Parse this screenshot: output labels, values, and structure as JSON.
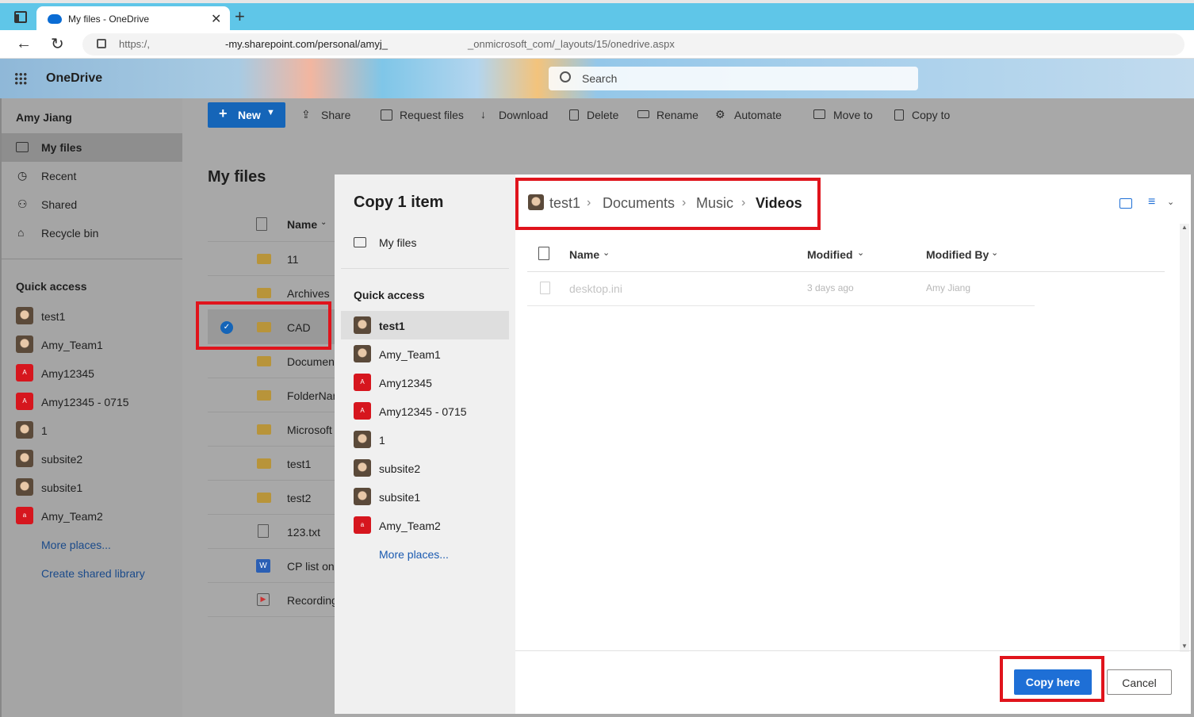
{
  "browser": {
    "tab_title": "My files - OneDrive",
    "tab_close": "✕",
    "new_tab": "+",
    "url_prefix": "https:/,",
    "url_middle": "-my.sharepoint.com/personal/amyj_",
    "url_suffix": "_onmicrosoft_com/_layouts/15/onedrive.aspx"
  },
  "header": {
    "app_name": "OneDrive",
    "search_placeholder": "Search"
  },
  "sidebar": {
    "user": "Amy Jiang",
    "nav": [
      {
        "label": "My files"
      },
      {
        "label": "Recent"
      },
      {
        "label": "Shared"
      },
      {
        "label": "Recycle bin"
      }
    ],
    "quick_access_title": "Quick access",
    "quick_access": [
      {
        "label": "test1",
        "avatar": "photo"
      },
      {
        "label": "Amy_Team1",
        "avatar": "photo"
      },
      {
        "label": "Amy12345",
        "avatar": "red",
        "letter": "A"
      },
      {
        "label": "Amy12345 - 0715",
        "avatar": "red",
        "letter": "A"
      },
      {
        "label": "1",
        "avatar": "photo"
      },
      {
        "label": "subsite2",
        "avatar": "photo"
      },
      {
        "label": "subsite1",
        "avatar": "photo"
      },
      {
        "label": "Amy_Team2",
        "avatar": "red",
        "letter": "a"
      }
    ],
    "more_places": "More places...",
    "create_library": "Create shared library"
  },
  "toolbar": {
    "new": "New",
    "share": "Share",
    "request_files": "Request files",
    "download": "Download",
    "delete": "Delete",
    "rename": "Rename",
    "automate": "Automate",
    "move_to": "Move to",
    "copy_to": "Copy to"
  },
  "file_list": {
    "title": "My files",
    "name_header": "Name",
    "items": [
      {
        "name": "11",
        "type": "folder"
      },
      {
        "name": "Archives",
        "type": "folder"
      },
      {
        "name": "CAD",
        "type": "folder",
        "selected": true
      },
      {
        "name": "Documen",
        "type": "folder"
      },
      {
        "name": "FolderNar",
        "type": "folder"
      },
      {
        "name": "Microsoft",
        "type": "folder"
      },
      {
        "name": "test1",
        "type": "folder"
      },
      {
        "name": "test2",
        "type": "folder"
      },
      {
        "name": "123.txt",
        "type": "txt"
      },
      {
        "name": "CP list on",
        "type": "word"
      },
      {
        "name": "Recording",
        "type": "video"
      }
    ]
  },
  "modal": {
    "title": "Copy 1 item",
    "my_files": "My files",
    "quick_access_title": "Quick access",
    "quick_access": [
      {
        "label": "test1",
        "avatar": "photo",
        "selected": true
      },
      {
        "label": "Amy_Team1",
        "avatar": "photo"
      },
      {
        "label": "Amy12345",
        "avatar": "red",
        "letter": "A"
      },
      {
        "label": "Amy12345 - 0715",
        "avatar": "red",
        "letter": "A"
      },
      {
        "label": "1",
        "avatar": "photo"
      },
      {
        "label": "subsite2",
        "avatar": "photo"
      },
      {
        "label": "subsite1",
        "avatar": "photo"
      },
      {
        "label": "Amy_Team2",
        "avatar": "red",
        "letter": "a"
      }
    ],
    "more_places": "More places...",
    "breadcrumb": [
      "test1",
      "Documents",
      "Music",
      "Videos"
    ],
    "columns": {
      "name": "Name",
      "modified": "Modified",
      "modified_by": "Modified By"
    },
    "rows": [
      {
        "name": "desktop.ini",
        "modified": "3 days ago",
        "modified_by": "Amy Jiang"
      }
    ],
    "copy_here": "Copy here",
    "cancel": "Cancel"
  },
  "colors": {
    "accent": "#1e6fd6",
    "highlight": "#e0141c",
    "tabbar": "#5fc6e8"
  }
}
